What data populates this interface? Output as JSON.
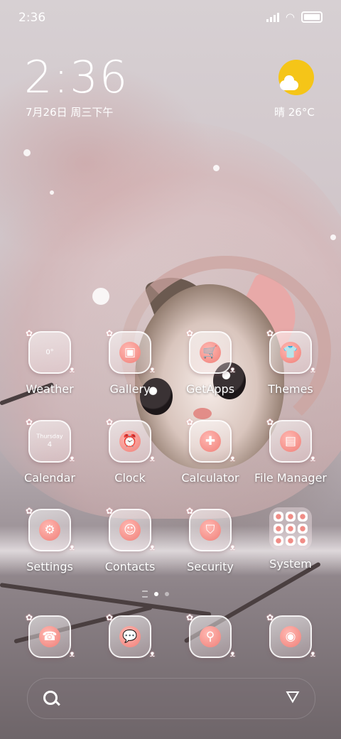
{
  "status_bar": {
    "time": "2:36"
  },
  "clock_widget": {
    "time": "2:36",
    "date": "7月26日 周三下午"
  },
  "weather_widget": {
    "text": "晴 26°C",
    "icon": "sun-cloud-icon"
  },
  "apps_row1": [
    {
      "label": "Weather",
      "icon": "weather-icon",
      "glyph": "0°"
    },
    {
      "label": "Gallery",
      "icon": "gallery-icon",
      "glyph": "▣"
    },
    {
      "label": "GetApps",
      "icon": "getapps-icon",
      "glyph": "🛒"
    },
    {
      "label": "Themes",
      "icon": "themes-icon",
      "glyph": "👕"
    }
  ],
  "apps_row2": [
    {
      "label": "Calendar",
      "icon": "calendar-icon",
      "day": "Thursday",
      "num": "4"
    },
    {
      "label": "Clock",
      "icon": "clock-icon",
      "glyph": "⏰"
    },
    {
      "label": "Calculator",
      "icon": "calculator-icon",
      "glyph": "✚"
    },
    {
      "label": "File Manager",
      "icon": "file-manager-icon",
      "glyph": "▤"
    }
  ],
  "apps_row3": [
    {
      "label": "Settings",
      "icon": "settings-icon",
      "glyph": "⚙"
    },
    {
      "label": "Contacts",
      "icon": "contacts-icon",
      "glyph": "☺"
    },
    {
      "label": "Security",
      "icon": "security-icon",
      "glyph": "⛉"
    },
    {
      "label": "System",
      "icon": "system-folder-icon"
    }
  ],
  "dock": [
    {
      "icon": "phone-icon",
      "glyph": "☎"
    },
    {
      "icon": "messages-icon",
      "glyph": "💬"
    },
    {
      "icon": "browser-icon",
      "glyph": "⚲"
    },
    {
      "icon": "camera-icon",
      "glyph": "◉"
    }
  ],
  "colors": {
    "accent": "#f07f78",
    "sun": "#f5c518"
  }
}
